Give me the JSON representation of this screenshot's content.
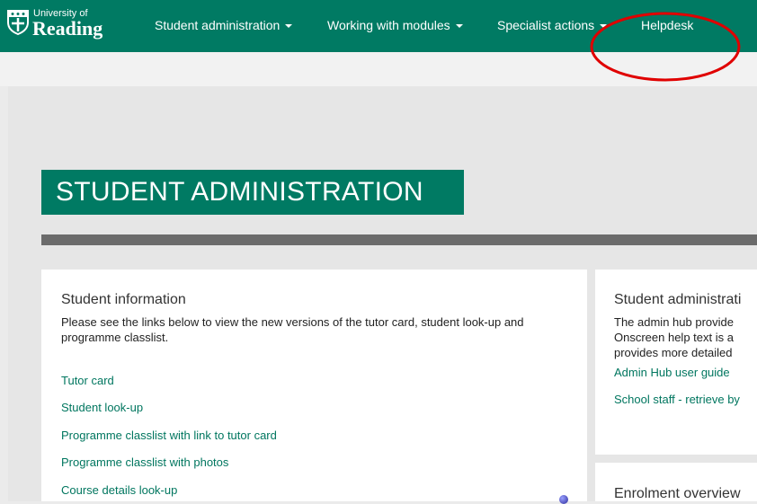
{
  "header": {
    "logo": {
      "line1": "University of",
      "line2": "Reading"
    },
    "nav": [
      {
        "label": "Student administration",
        "has_caret": true
      },
      {
        "label": "Working with modules",
        "has_caret": true
      },
      {
        "label": "Specialist actions",
        "has_caret": true
      },
      {
        "label": "Helpdesk",
        "has_caret": false
      }
    ]
  },
  "page": {
    "title": "STUDENT ADMINISTRATION"
  },
  "student_info": {
    "heading": "Student information",
    "description": "Please see the links below to view the new versions of the tutor card, student look-up and programme classlist.",
    "links": [
      "Tutor card",
      "Student look-up",
      "Programme classlist with link to tutor card",
      "Programme classlist with photos",
      "Course details look-up"
    ]
  },
  "student_admin_panel": {
    "heading": "Student administrati",
    "lines": [
      "The admin hub provide",
      "Onscreen help text is a",
      "provides more detailed"
    ],
    "links": [
      "Admin Hub user guide",
      "School staff - retrieve by"
    ]
  },
  "enrolment_panel": {
    "heading": "Enrolment overview"
  },
  "colors": {
    "brand_green": "#007a63",
    "link_green": "#00765f",
    "annotation_red": "#e00000"
  }
}
